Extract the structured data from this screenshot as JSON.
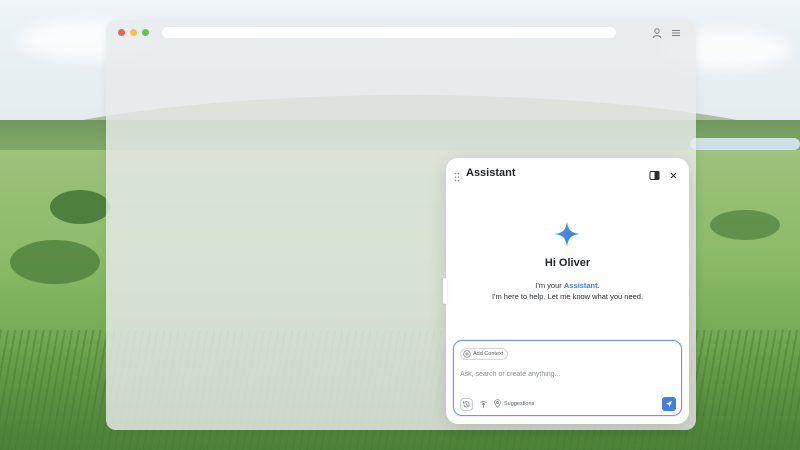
{
  "browser": {
    "window_controls": [
      "close",
      "minimize",
      "maximize"
    ],
    "url": "",
    "icons": {
      "profile": "user-icon",
      "menu": "hamburger-menu-icon"
    }
  },
  "assistant": {
    "title": "Assistant",
    "greeting": "Hi Oliver",
    "intro_prefix": "I'm your ",
    "intro_name": "Assistant.",
    "intro_line2": "I'm here to help. Let me know what you need.",
    "composer": {
      "add_context_label": "Add Context",
      "placeholder": "Ask, search or create anything...",
      "value": "",
      "suggestions_label": "Suggestions"
    },
    "colors": {
      "accent": "#3b7de0",
      "send_button": "#3f7fe6",
      "composer_border": "#7d8ef0"
    }
  }
}
